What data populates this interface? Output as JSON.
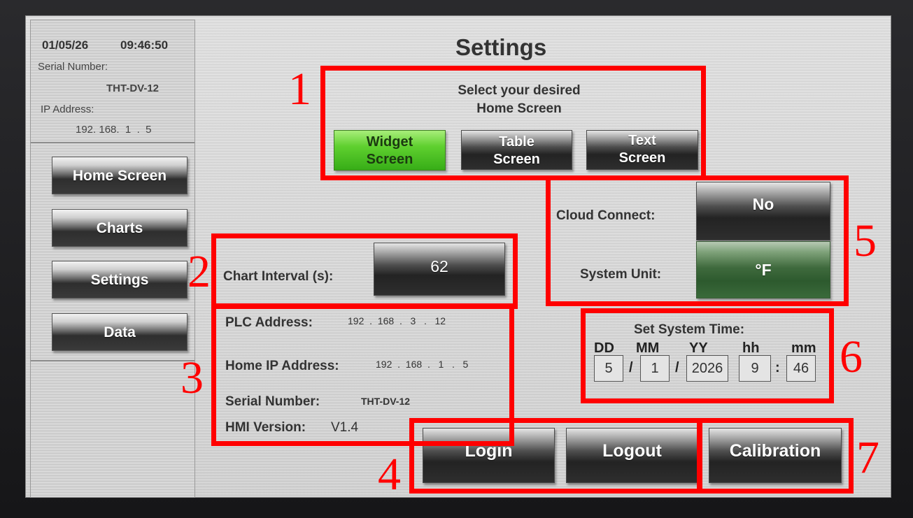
{
  "status": {
    "date": "01/05/26",
    "time": "09:46:50",
    "serial_label": "Serial Number:",
    "serial_value": "THT-DV-12",
    "ip_label": "IP Address:",
    "ip_value": "192. 168.  1  .  5"
  },
  "nav": {
    "items": [
      {
        "label": "Home Screen"
      },
      {
        "label": "Charts"
      },
      {
        "label": "Settings"
      },
      {
        "label": "Data"
      }
    ]
  },
  "page": {
    "title": "Settings"
  },
  "home_screen": {
    "prompt_line1": "Select your desired",
    "prompt_line2": "Home Screen",
    "options": [
      {
        "line1": "Widget",
        "line2": "Screen",
        "selected": true
      },
      {
        "line1": "Table",
        "line2": "Screen",
        "selected": false
      },
      {
        "line1": "Text",
        "line2": "Screen",
        "selected": false
      }
    ]
  },
  "chart_interval": {
    "label": "Chart Interval (s):",
    "value": "62"
  },
  "network": {
    "plc_label": "PLC Address:",
    "plc_value": "192  .  168  .   3   .   12",
    "home_ip_label": "Home IP Address:",
    "home_ip_value": "192  .  168  .   1   .   5",
    "serial_label": "Serial Number:",
    "serial_value": "THT-DV-12",
    "hmi_label": "HMI Version:",
    "hmi_value": "V1.4"
  },
  "cloud": {
    "label": "Cloud Connect:",
    "value": "No"
  },
  "unit": {
    "label": "System Unit:",
    "value": "°F"
  },
  "system_time": {
    "title": "Set System Time:",
    "headers": {
      "dd": "DD",
      "mm": "MM",
      "yy": "YY",
      "hh": "hh",
      "min": "mm"
    },
    "values": {
      "dd": "5",
      "mm": "1",
      "yy": "2026",
      "hh": "9",
      "min": "46"
    },
    "date_sep": "/",
    "time_sep": ":"
  },
  "actions": {
    "login": "Login",
    "logout": "Logout",
    "calibration": "Calibration"
  },
  "callouts": [
    "1",
    "2",
    "3",
    "4",
    "5",
    "6",
    "7"
  ],
  "colors": {
    "highlight": "#ff0000",
    "selected_green": "#4fc227"
  }
}
